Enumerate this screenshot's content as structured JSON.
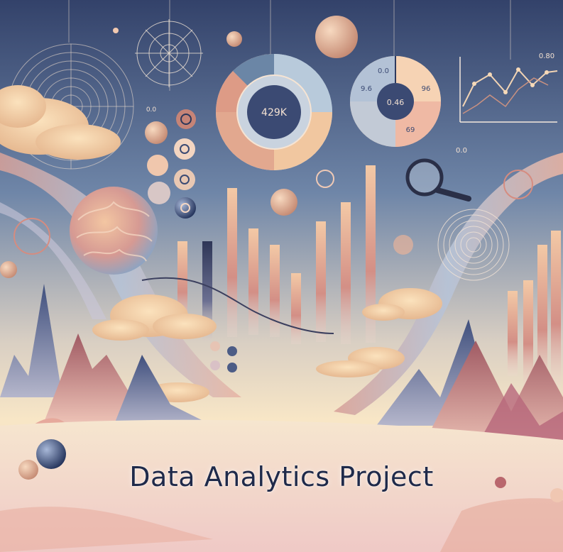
{
  "title": "Data Analytics Project",
  "donut_center_label": "429K",
  "pie_center_label": "0.46",
  "pie_labels": [
    "0.0",
    "9.6",
    "96",
    "69"
  ],
  "line_chart_label": "0.80",
  "bars_label": "0.0",
  "side_label": "0.0",
  "colors": {
    "sky_top": "#34436b",
    "sky_mid": "#7d8fae",
    "horizon": "#f6e2c2",
    "water": "#f2d8d6",
    "peach": "#f1c3a1",
    "rose": "#d88e8b",
    "slate": "#5c6f9a",
    "navy": "#1f2a4a",
    "cream": "#f8e7c9"
  }
}
